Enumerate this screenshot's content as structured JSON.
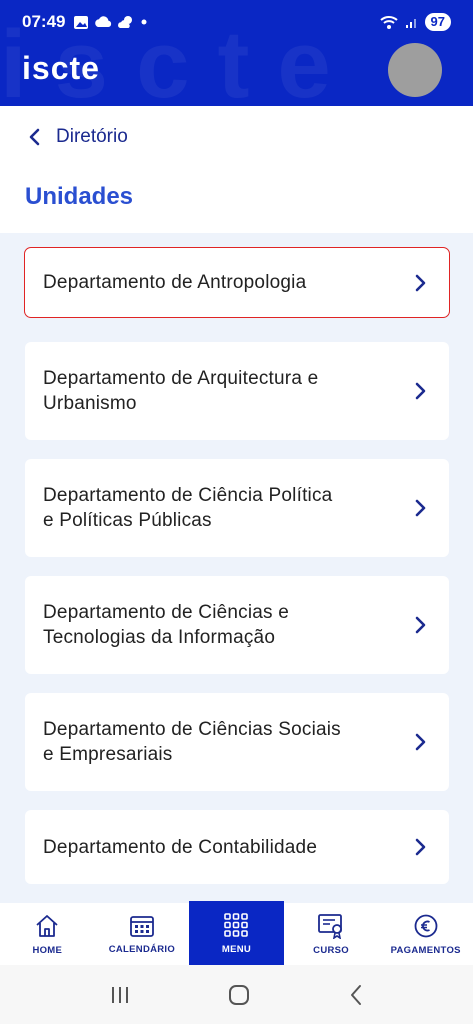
{
  "status_bar": {
    "time": "07:49",
    "battery": "97"
  },
  "header": {
    "logo": "iscte",
    "watermark": "iscte"
  },
  "back": {
    "label": "Diretório"
  },
  "section": {
    "title": "Unidades"
  },
  "units": [
    {
      "lines": [
        "Departamento de Antropologia"
      ]
    },
    {
      "lines": [
        "Departamento de Arquitectura e",
        "Urbanismo"
      ]
    },
    {
      "lines": [
        "Departamento de Ciência Política",
        "e Políticas Públicas"
      ]
    },
    {
      "lines": [
        "Departamento de Ciências e",
        "Tecnologias da Informação"
      ]
    },
    {
      "lines": [
        "Departamento de Ciências Sociais",
        "e Empresariais"
      ]
    },
    {
      "lines": [
        "Departamento de Contabilidade"
      ]
    }
  ],
  "bottom_nav": [
    {
      "label": "HOME",
      "icon": "home-icon"
    },
    {
      "label": "CALENDÁRIO",
      "icon": "calendar-icon"
    },
    {
      "label": "MENU",
      "icon": "grid-menu-icon",
      "active": true
    },
    {
      "label": "CURSO",
      "icon": "certificate-icon"
    },
    {
      "label": "PAGAMENTOS",
      "icon": "euro-icon"
    }
  ],
  "colors": {
    "brand": "#0a27c4",
    "title": "#2a4fd1",
    "highlight": "#e02424"
  }
}
